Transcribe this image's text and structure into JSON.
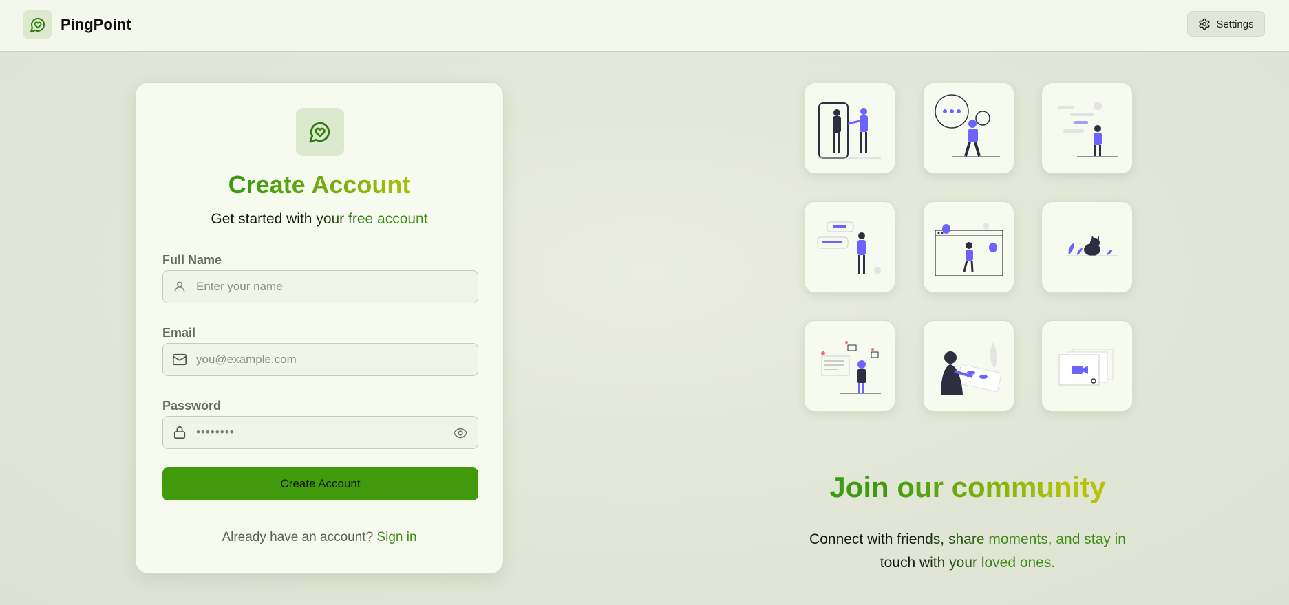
{
  "app": {
    "name": "PingPoint"
  },
  "header": {
    "settings_label": "Settings"
  },
  "signup": {
    "title": "Create Account",
    "subtitle": "Get started with your free account",
    "fields": {
      "name": {
        "label": "Full Name",
        "placeholder": "Enter your name"
      },
      "email": {
        "label": "Email",
        "placeholder": "you@example.com"
      },
      "password": {
        "label": "Password",
        "value": "••••••••"
      }
    },
    "submit_label": "Create Account",
    "signin_prompt": "Already have an account?",
    "signin_link": "Sign in"
  },
  "community": {
    "title": "Join our community",
    "text": "Connect with friends, share moments, and stay in touch with your loved ones.",
    "illustrations": [
      "phone-handshake-illustration",
      "chat-bubble-illustration",
      "messaging-illustration",
      "conversation-illustration",
      "browser-balloons-illustration",
      "cat-plants-illustration",
      "notifications-illustration",
      "photo-sharing-illustration",
      "video-call-illustration"
    ]
  },
  "colors": {
    "accent": "#419a0c",
    "accent_light": "#b6c20c",
    "illustration": "#6c63ff",
    "background": "#e1e6d6",
    "card": "#f7fbef"
  }
}
